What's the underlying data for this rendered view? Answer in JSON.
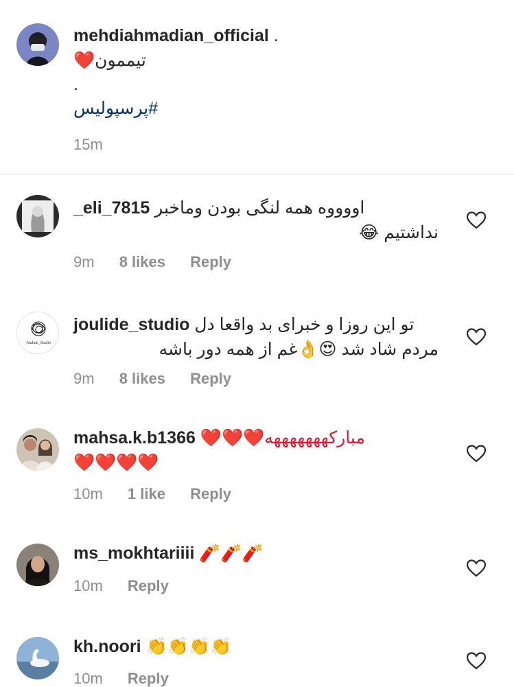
{
  "caption": {
    "username": "mehdiahmadian_official",
    "suffix": " .",
    "line1": "تیممون❤️",
    "line2": ".",
    "hashtag": "#پرسپولیس",
    "time": "15m"
  },
  "comments": [
    {
      "username": "_eli_7815",
      "line1": "اووووه همه لنگی بودن وماخبر",
      "line2": "نداشتیم 😂",
      "time": "9m",
      "likes": "8 likes",
      "reply": "Reply"
    },
    {
      "username": "joulide_studio",
      "line1": "تو این روزا و خبرای بد واقعا دل",
      "line2": "مردم شاد شد 😍👌غم از همه دور باشه",
      "time": "9m",
      "likes": "8 likes",
      "reply": "Reply",
      "avatar_text": "Joulide_Studio"
    },
    {
      "username": "mahsa.k.b1366",
      "line1": "مبارکهههههههه❤️❤️❤️",
      "line2": "❤️❤️❤️❤️",
      "time": "10m",
      "likes": "1 like",
      "reply": "Reply"
    },
    {
      "username": "ms_mokhtariiii",
      "line1": "🧨🧨🧨",
      "time": "10m",
      "reply": "Reply"
    },
    {
      "username": "kh.noori",
      "line1": "👏👏👏👏",
      "time": "10m",
      "reply": "Reply"
    }
  ],
  "icons": {
    "like": "heart-outline-icon"
  },
  "colors": {
    "text": "#262626",
    "meta": "#8e8e8e",
    "hashtag": "#003569",
    "divider": "#dbdbdb"
  }
}
